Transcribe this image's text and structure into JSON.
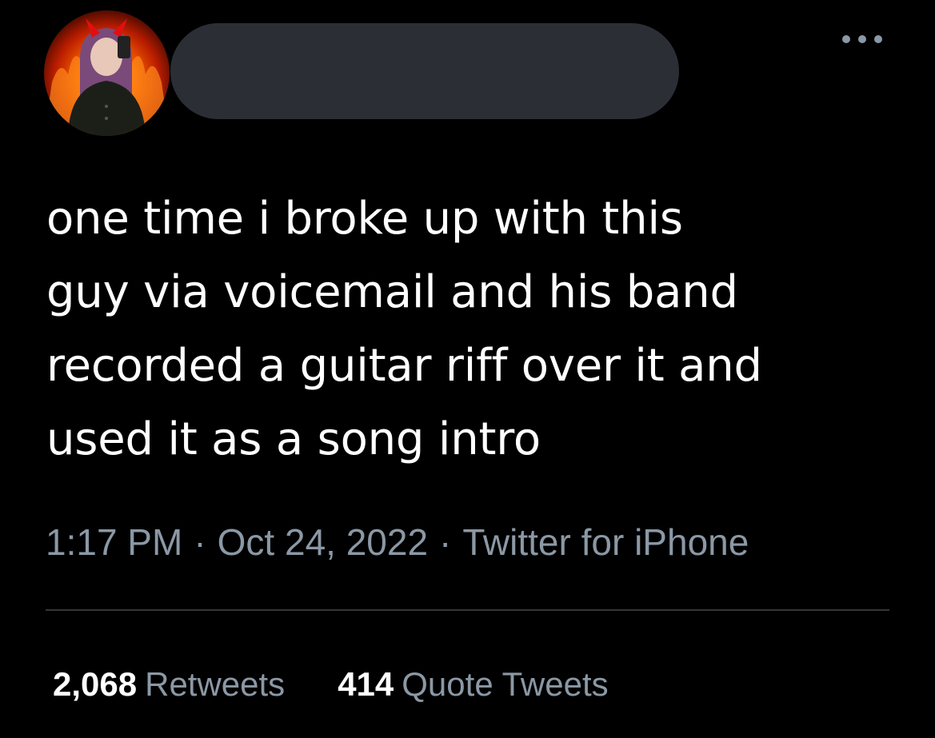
{
  "tweet": {
    "text": "one time i broke up with this\nguy via voicemail and his band\nrecorded a guitar riff over it and\nused it as a song intro",
    "time": "1:17 PM",
    "date": "Oct 24, 2022",
    "separator": "·",
    "source": "Twitter for iPhone"
  },
  "stats": {
    "retweets": {
      "count": "2,068",
      "label": "Retweets"
    },
    "quote_tweets": {
      "count": "414",
      "label": "Quote Tweets"
    }
  },
  "icons": {
    "more": "more-horizontal-icon"
  },
  "colors": {
    "background": "#000000",
    "text": "#ffffff",
    "secondary": "#8b98a5",
    "divider": "#333639",
    "redaction": "#2b2f35"
  }
}
